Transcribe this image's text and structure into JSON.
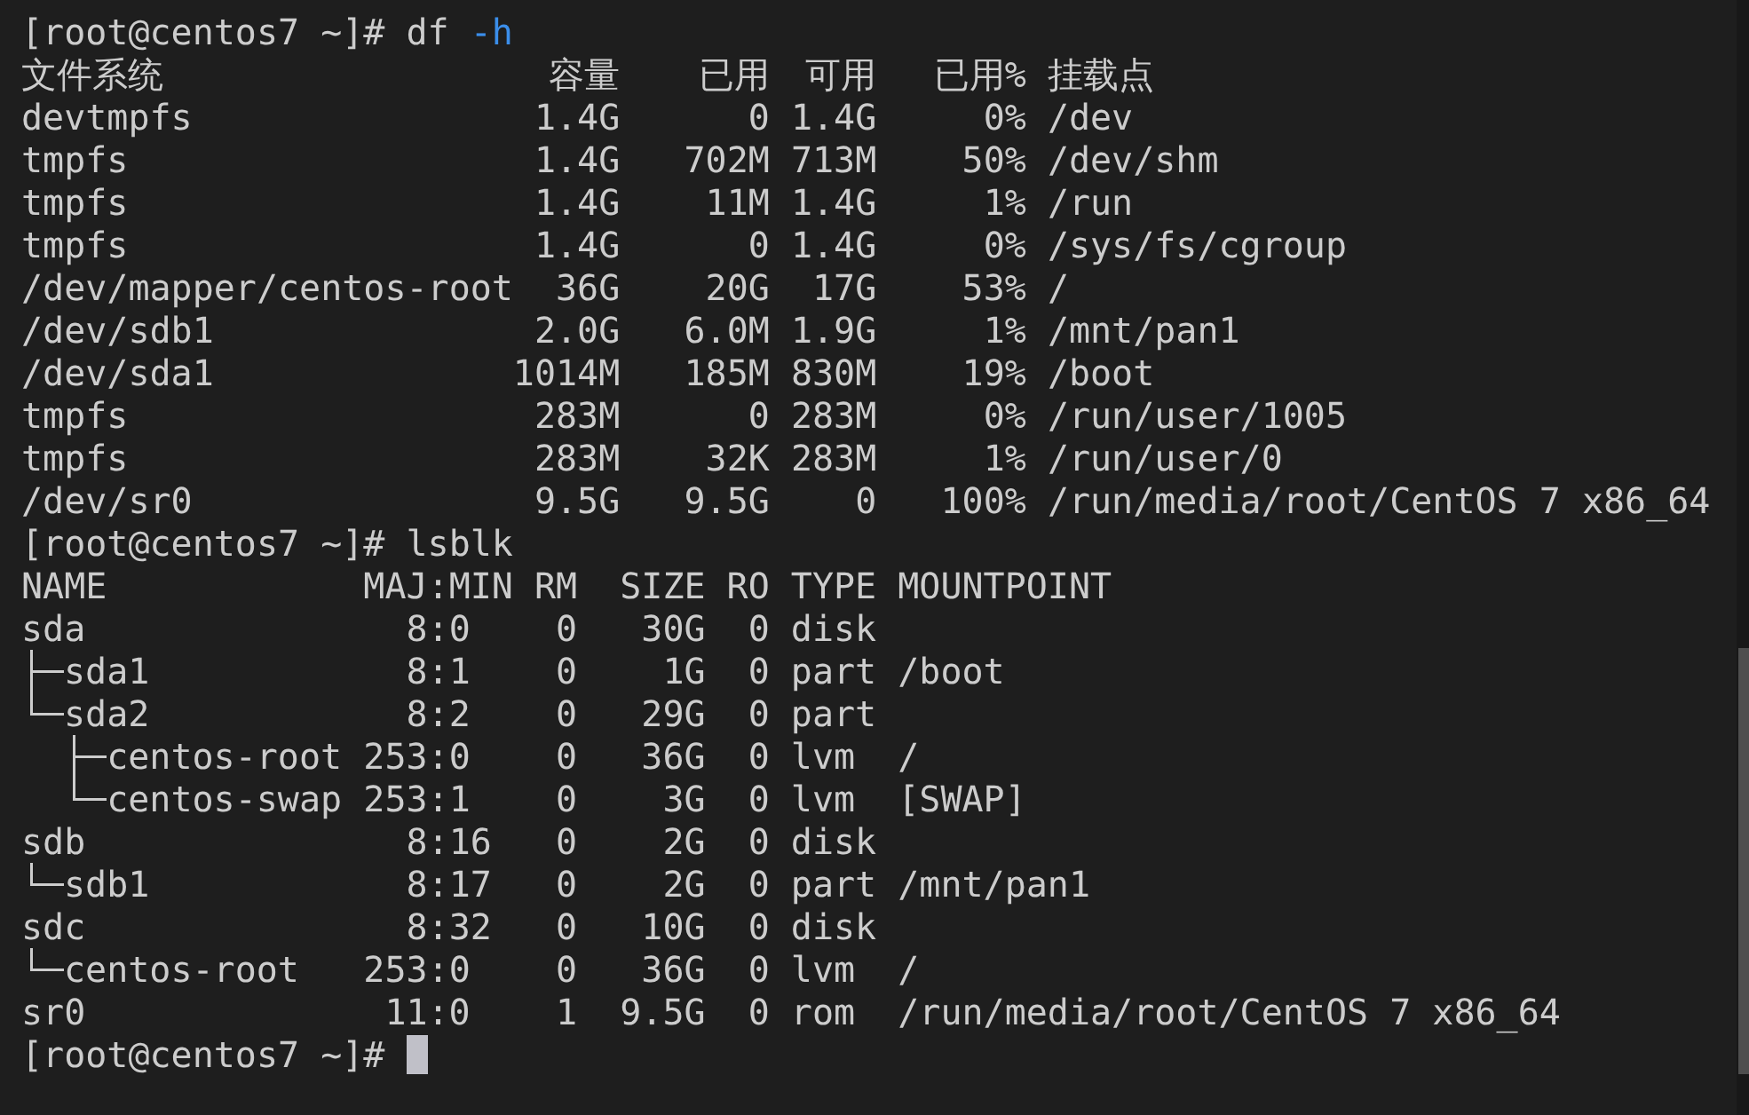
{
  "terminal": {
    "blocks": [
      {
        "kind": "prompt",
        "prompt": "[root@centos7 ~]#",
        "command": "df",
        "option": "-h"
      },
      {
        "kind": "df_table",
        "columns": [
          "文件系统",
          "容量",
          "已用",
          "可用",
          "已用%",
          "挂载点"
        ],
        "rows": [
          [
            "devtmpfs",
            "1.4G",
            "0",
            "1.4G",
            "0%",
            "/dev"
          ],
          [
            "tmpfs",
            "1.4G",
            "702M",
            "713M",
            "50%",
            "/dev/shm"
          ],
          [
            "tmpfs",
            "1.4G",
            "11M",
            "1.4G",
            "1%",
            "/run"
          ],
          [
            "tmpfs",
            "1.4G",
            "0",
            "1.4G",
            "0%",
            "/sys/fs/cgroup"
          ],
          [
            "/dev/mapper/centos-root",
            "36G",
            "20G",
            "17G",
            "53%",
            "/"
          ],
          [
            "/dev/sdb1",
            "2.0G",
            "6.0M",
            "1.9G",
            "1%",
            "/mnt/pan1"
          ],
          [
            "/dev/sda1",
            "1014M",
            "185M",
            "830M",
            "19%",
            "/boot"
          ],
          [
            "tmpfs",
            "283M",
            "0",
            "283M",
            "0%",
            "/run/user/1005"
          ],
          [
            "tmpfs",
            "283M",
            "32K",
            "283M",
            "1%",
            "/run/user/0"
          ],
          [
            "/dev/sr0",
            "9.5G",
            "9.5G",
            "0",
            "100%",
            "/run/media/root/CentOS 7 x86_64"
          ]
        ]
      },
      {
        "kind": "prompt",
        "prompt": "[root@centos7 ~]#",
        "command": "lsblk"
      },
      {
        "kind": "lsblk_tree",
        "columns": [
          "NAME",
          "MAJ:MIN",
          "RM",
          "SIZE",
          "RO",
          "TYPE",
          "MOUNTPOINT"
        ],
        "devices": [
          {
            "name": "sda",
            "maj_min": "8:0",
            "rm": "0",
            "size": "30G",
            "ro": "0",
            "type": "disk",
            "children": [
              {
                "name": "sda1",
                "maj_min": "8:1",
                "rm": "0",
                "size": "1G",
                "ro": "0",
                "type": "part",
                "mountpoint": "/boot"
              },
              {
                "name": "sda2",
                "maj_min": "8:2",
                "rm": "0",
                "size": "29G",
                "ro": "0",
                "type": "part",
                "children": [
                  {
                    "name": "centos-root",
                    "maj_min": "253:0",
                    "rm": "0",
                    "size": "36G",
                    "ro": "0",
                    "type": "lvm",
                    "mountpoint": "/"
                  },
                  {
                    "name": "centos-swap",
                    "maj_min": "253:1",
                    "rm": "0",
                    "size": "3G",
                    "ro": "0",
                    "type": "lvm",
                    "mountpoint": "[SWAP]"
                  }
                ]
              }
            ]
          },
          {
            "name": "sdb",
            "maj_min": "8:16",
            "rm": "0",
            "size": "2G",
            "ro": "0",
            "type": "disk",
            "children": [
              {
                "name": "sdb1",
                "maj_min": "8:17",
                "rm": "0",
                "size": "2G",
                "ro": "0",
                "type": "part",
                "mountpoint": "/mnt/pan1"
              }
            ]
          },
          {
            "name": "sdc",
            "maj_min": "8:32",
            "rm": "0",
            "size": "10G",
            "ro": "0",
            "type": "disk",
            "children": [
              {
                "name": "centos-root",
                "maj_min": "253:0",
                "rm": "0",
                "size": "36G",
                "ro": "0",
                "type": "lvm",
                "mountpoint": "/"
              }
            ]
          },
          {
            "name": "sr0",
            "maj_min": "11:0",
            "rm": "1",
            "size": "9.5G",
            "ro": "0",
            "type": "rom",
            "mountpoint": "/run/media/root/CentOS 7 x86_64"
          }
        ]
      },
      {
        "kind": "prompt",
        "prompt": "[root@centos7 ~]#",
        "cursor": true
      }
    ]
  }
}
